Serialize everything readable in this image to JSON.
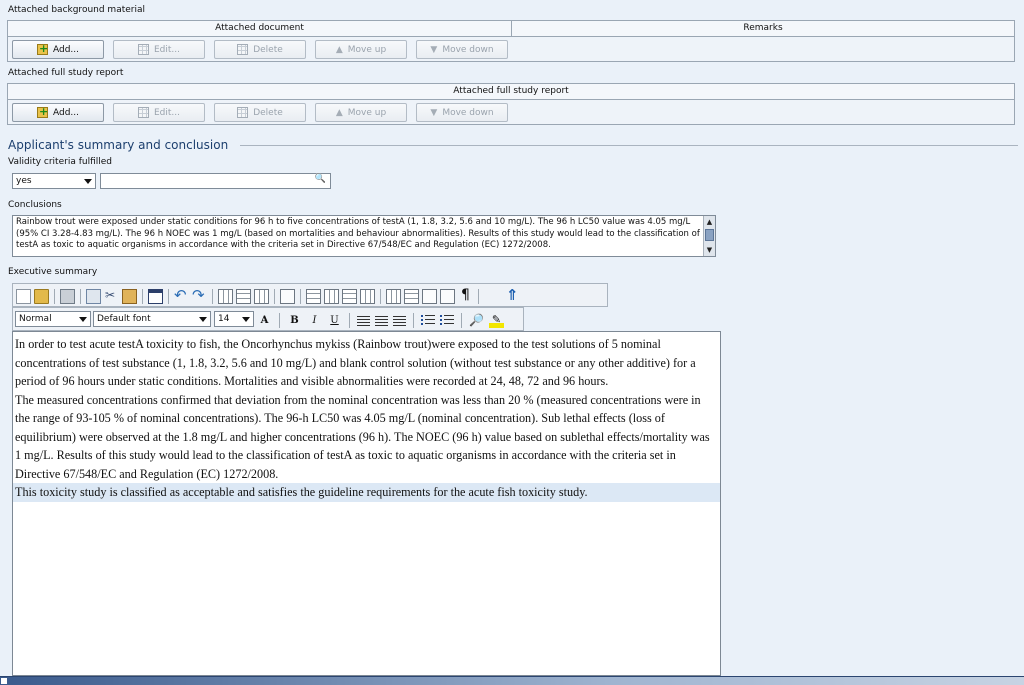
{
  "background_material": {
    "section_label": "Attached background material",
    "columns": [
      "Attached document",
      "Remarks"
    ],
    "buttons": {
      "add": "Add...",
      "edit": "Edit...",
      "delete": "Delete",
      "move_up": "Move up",
      "move_down": "Move down"
    }
  },
  "full_study_report": {
    "section_label": "Attached full study report",
    "columns": [
      "Attached full study report"
    ],
    "buttons": {
      "add": "Add...",
      "edit": "Edit...",
      "delete": "Delete",
      "move_up": "Move up",
      "move_down": "Move down"
    }
  },
  "summary": {
    "title": "Applicant's summary and conclusion",
    "validity_label": "Validity criteria fulfilled",
    "validity_value": "yes",
    "validity_remark": "",
    "conclusions_label": "Conclusions",
    "conclusions_text": "Rainbow trout were exposed under static conditions for 96 h to five concentrations of testA (1, 1.8, 3.2, 5.6 and 10 mg/L). The 96 h LC50 value was 4.05 mg/L (95% CI 3.28-4.83 mg/L). The 96 h NOEC was 1 mg/L (based on mortalities and behaviour abnormalities). Results of this study would lead to the classification of testA as toxic to aquatic organisms in accordance with the criteria set in Directive 67/548/EC and Regulation (EC) 1272/2008.",
    "executive_label": "Executive summary"
  },
  "editor": {
    "style_value": "Normal",
    "font_value": "Default font",
    "size_value": "14",
    "font_size_icon": "A",
    "bold": "B",
    "italic": "I",
    "underline": "U",
    "paragraphs": [
      "In order to test acute testA toxicity to fish, the Oncorhynchus mykiss (Rainbow trout)were exposed to the test solutions of 5 nominal concentrations of test substance (1, 1.8, 3.2, 5.6 and 10 mg/L) and blank control solution (without test substance or any other additive) for a period of 96 hours under static conditions. Mortalities and visible abnormalities were recorded at 24, 48, 72 and 96 hours.",
      "The measured concentrations confirmed that deviation from the nominal concentration was less than 20 % (measured concentrations were in the range of 93-105 % of nominal concentrations). The 96-h LC50 was 4.05 mg/L (nominal concentration). Sub lethal effects (loss of equilibrium) were observed at the 1.8 mg/L and higher concentrations (96 h). The NOEC (96 h) value based on sublethal effects/mortality was 1 mg/L. Results of this study would lead to the classification of testA as toxic to aquatic organisms in accordance with the criteria set in Directive 67/548/EC and Regulation (EC) 1272/2008.",
      "This toxicity study is classified as acceptable and satisfies the guideline requirements for the acute fish toxicity study."
    ]
  },
  "colors": {
    "background": "#eaf1f9",
    "section_title": "#1c3f6e",
    "selection": "#dce8f5"
  }
}
